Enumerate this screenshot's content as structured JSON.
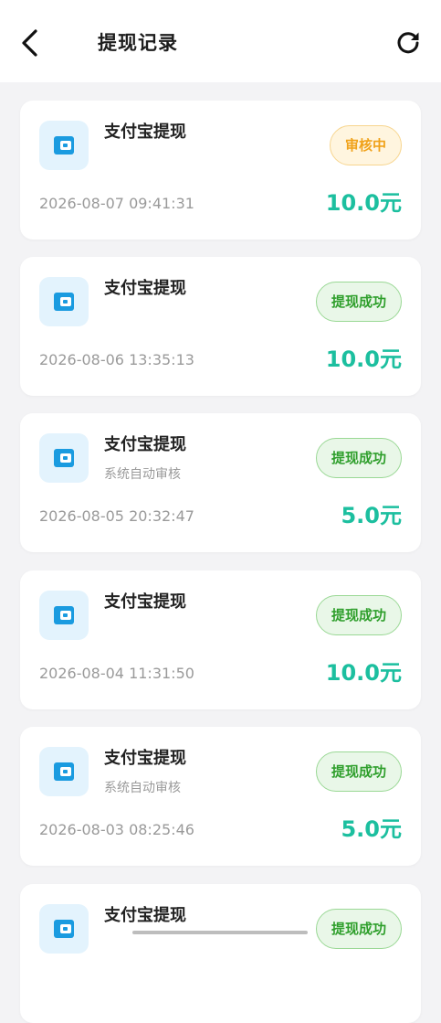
{
  "header": {
    "title": "提现记录",
    "back_icon": "chevron-left-icon",
    "refresh_icon": "refresh-icon"
  },
  "colors": {
    "amount": "#1cbf9f",
    "pending_badge": "#f0a21a",
    "success_badge": "#2f9f2c",
    "icon_bg": "#e3f3fd",
    "icon_fg": "#1a9be0"
  },
  "records": [
    {
      "title": "支付宝提现",
      "subtitle": "",
      "status": "审核中",
      "status_type": "pending",
      "time": "2026-08-07 09:41:31",
      "amount": "10.0元",
      "icon": "wallet-icon"
    },
    {
      "title": "支付宝提现",
      "subtitle": "",
      "status": "提现成功",
      "status_type": "success",
      "time": "2026-08-06 13:35:13",
      "amount": "10.0元",
      "icon": "wallet-icon"
    },
    {
      "title": "支付宝提现",
      "subtitle": "系统自动审核",
      "status": "提现成功",
      "status_type": "success",
      "time": "2026-08-05 20:32:47",
      "amount": "5.0元",
      "icon": "wallet-icon"
    },
    {
      "title": "支付宝提现",
      "subtitle": "",
      "status": "提现成功",
      "status_type": "success",
      "time": "2026-08-04 11:31:50",
      "amount": "10.0元",
      "icon": "wallet-icon"
    },
    {
      "title": "支付宝提现",
      "subtitle": "系统自动审核",
      "status": "提现成功",
      "status_type": "success",
      "time": "2026-08-03 08:25:46",
      "amount": "5.0元",
      "icon": "wallet-icon"
    },
    {
      "title": "支付宝提现",
      "subtitle": "",
      "status": "提现成功",
      "status_type": "success",
      "time": "",
      "amount": "",
      "icon": "wallet-icon"
    }
  ]
}
